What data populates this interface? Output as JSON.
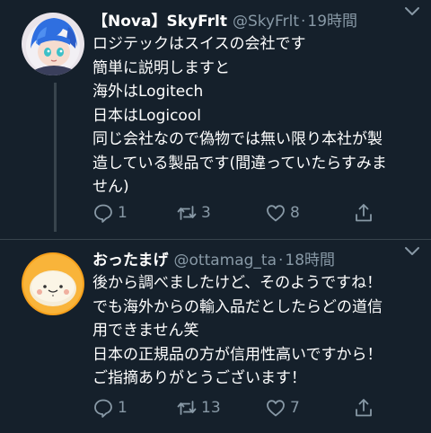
{
  "tweets": [
    {
      "name": "【Nova】SkyFrlt",
      "handle": "@SkyFrlt",
      "dot": "·",
      "time": "19時間",
      "lines": [
        "ロジテックはスイスの会社です",
        "簡単に説明しますと",
        "海外はLogitech",
        "日本はLogicool",
        "同じ会社なので偽物では無い限り本社が製",
        "造している製品です(間違っていたらすみま",
        "せん)"
      ],
      "replies": "1",
      "retweets": "3",
      "likes": "8"
    },
    {
      "name": "おったまげ",
      "handle": "@ottamag_ta",
      "dot": "·",
      "time": "18時間",
      "lines": [
        "後から調べましたけど、そのようですね！",
        "でも海外からの輸入品だとしたらどの道信",
        "用できません笑",
        "日本の正規品の方が信用性高いですから！",
        "ご指摘ありがとうございます！"
      ],
      "replies": "1",
      "retweets": "13",
      "likes": "7"
    }
  ],
  "icons": {
    "reply": "reply-icon",
    "retweet": "retweet-icon",
    "like": "heart-icon",
    "share": "share-icon",
    "caret": "chevron-down-icon"
  },
  "colors": {
    "background": "#15202b",
    "text": "#ffffff",
    "muted": "#8899a6",
    "divider": "#38444d"
  }
}
